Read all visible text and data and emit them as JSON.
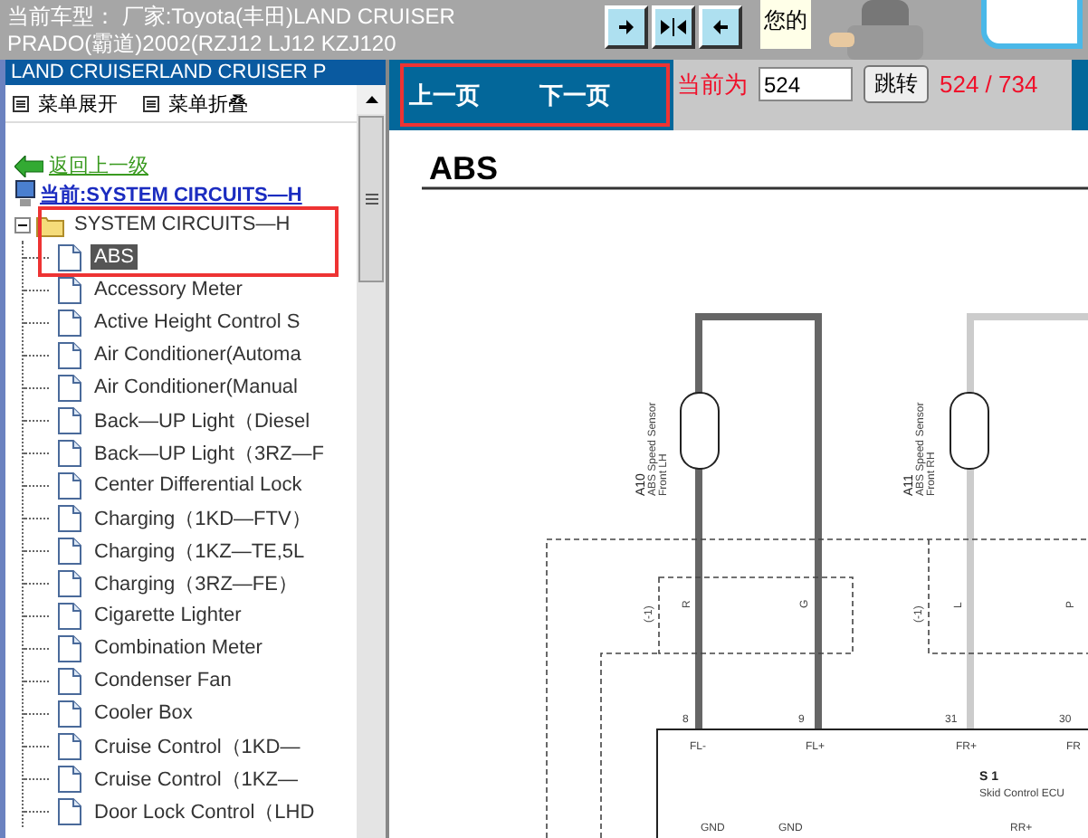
{
  "top_bar": {
    "vehicle_line1": "当前车型： 厂家:Toyota(丰田)LAND CRUISER",
    "vehicle_line2": "PRADO(霸道)2002(RZJ12 LJ12 KZJ120",
    "greeting": "您的"
  },
  "sidebar": {
    "header": "LAND CRUISERLAND CRUISER P",
    "menu": [
      "菜单展开",
      "菜单折叠"
    ],
    "back_link": "返回上一级",
    "current": "当前:SYSTEM CIRCUITS—H",
    "tree": [
      {
        "label": "SYSTEM CIRCUITS—H",
        "expanded": true,
        "selected": false,
        "children": [
          {
            "label": "ABS",
            "selected": true
          },
          {
            "label": "Accessory Meter",
            "selected": false
          },
          {
            "label": "Active Height Control S",
            "selected": false
          },
          {
            "label": "Air Conditioner(Automa",
            "selected": false
          },
          {
            "label": "Air Conditioner(Manual",
            "selected": false
          },
          {
            "label": "Back—UP Light（Diesel",
            "selected": false
          },
          {
            "label": "Back—UP Light（3RZ—F",
            "selected": false
          },
          {
            "label": "Center Differential Lock",
            "selected": false
          },
          {
            "label": "Charging（1KD—FTV）",
            "selected": false
          },
          {
            "label": "Charging（1KZ—TE,5L",
            "selected": false
          },
          {
            "label": "Charging（3RZ—FE）",
            "selected": false
          },
          {
            "label": "Cigarette Lighter",
            "selected": false
          },
          {
            "label": "Combination Meter",
            "selected": false
          },
          {
            "label": "Condenser Fan",
            "selected": false
          },
          {
            "label": "Cooler Box",
            "selected": false
          },
          {
            "label": "Cruise Control（1KD—",
            "selected": false
          },
          {
            "label": "Cruise Control（1KZ—",
            "selected": false
          },
          {
            "label": "Door Lock Control（LHD",
            "selected": false
          }
        ]
      }
    ]
  },
  "pager": {
    "prev": "上一页",
    "next": "下一页",
    "current_label": "当前为",
    "page_input": "524",
    "go_button": "跳转",
    "page_count": "524 / 734"
  },
  "document": {
    "title": "ABS",
    "labels": {
      "a10": "A10",
      "a10_name": "ABS Speed Sensor",
      "a10_side": "Front LH",
      "a11": "A11",
      "a11_name": "ABS Speed Sensor",
      "a11_side": "Front RH",
      "shield_left": "(-1)",
      "shield_right": "(-1)",
      "wire_r": "R",
      "wire_g": "G",
      "wire_l": "L",
      "wire_p": "P",
      "pin_8": "8",
      "pin_9": "9",
      "pin_31": "31",
      "pin_30": "30",
      "fl_minus": "FL-",
      "fl_plus": "FL+",
      "fr_plus": "FR+",
      "fr": "FR",
      "ecu_code": "S 1",
      "ecu_name": "Skid Control ECU",
      "gnd_1": "GND",
      "gnd_2": "GND",
      "rr_plus": "RR+"
    }
  }
}
